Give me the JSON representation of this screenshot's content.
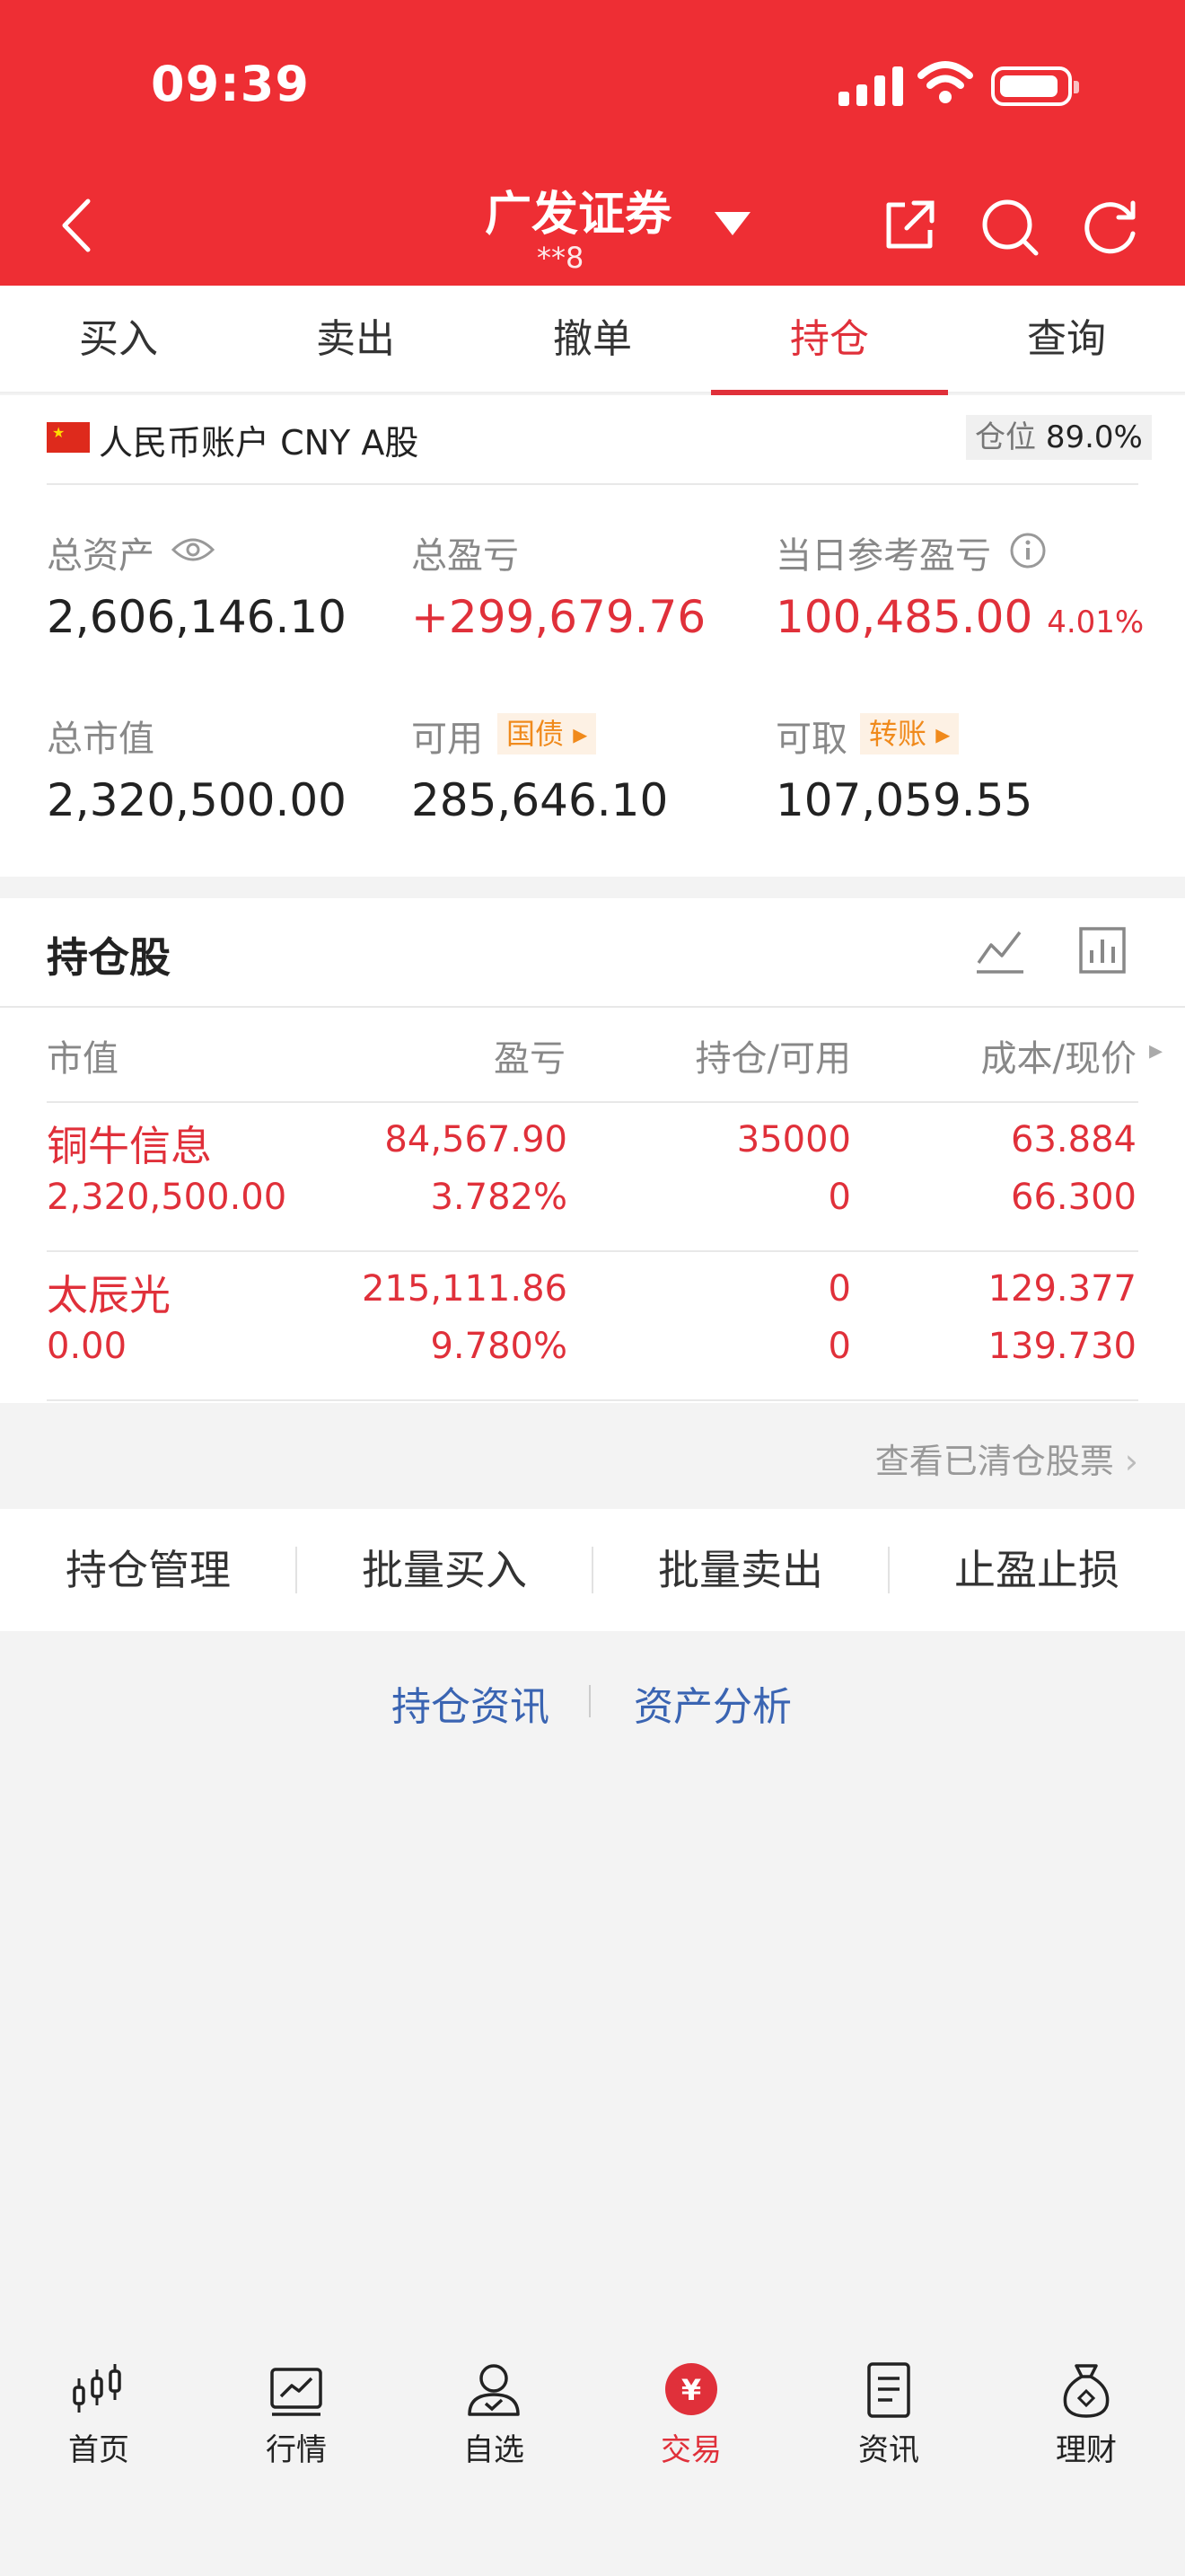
{
  "status_bar": {
    "time": "09:39"
  },
  "header": {
    "brand": "广发证券",
    "account_masked": "**8"
  },
  "tabs": [
    {
      "label": "买入"
    },
    {
      "label": "卖出"
    },
    {
      "label": "撤单"
    },
    {
      "label": "持仓",
      "active": true
    },
    {
      "label": "查询"
    }
  ],
  "account": {
    "label": "人民币账户 CNY A股",
    "position_label": "仓位",
    "position_value": "89.0%",
    "total_assets_label": "总资产",
    "total_assets": "2,606,146.10",
    "total_pnl_label": "总盈亏",
    "total_pnl": "+299,679.76",
    "daily_pnl_label": "当日参考盈亏",
    "daily_pnl": "100,485.00",
    "daily_pnl_pct": "4.01%",
    "market_value_label": "总市值",
    "market_value": "2,320,500.00",
    "available_label": "可用",
    "available_tag": "国债",
    "available": "285,646.10",
    "withdrawable_label": "可取",
    "withdrawable_tag": "转账",
    "withdrawable": "107,059.55"
  },
  "holdings": {
    "title": "持仓股",
    "columns": [
      "市值",
      "盈亏",
      "持仓/可用",
      "成本/现价"
    ],
    "rows": [
      {
        "name": "铜牛信息",
        "market_value": "2,320,500.00",
        "pnl": "84,567.90",
        "pnl_pct": "3.782%",
        "position": "35000",
        "available": "0",
        "cost": "63.884",
        "price": "66.300"
      },
      {
        "name": "太辰光",
        "market_value": "0.00",
        "pnl": "215,111.86",
        "pnl_pct": "9.780%",
        "position": "0",
        "available": "0",
        "cost": "129.377",
        "price": "139.730"
      }
    ],
    "cleared_link": "查看已清仓股票"
  },
  "actions": [
    "持仓管理",
    "批量买入",
    "批量卖出",
    "止盈止损"
  ],
  "links": [
    "持仓资讯",
    "资产分析"
  ],
  "bottom_nav": [
    {
      "label": "首页",
      "icon": "candlestick-icon"
    },
    {
      "label": "行情",
      "icon": "chart-icon"
    },
    {
      "label": "自选",
      "icon": "user-check-icon"
    },
    {
      "label": "交易",
      "icon": "yuan-coin-icon",
      "active": true
    },
    {
      "label": "资讯",
      "icon": "document-icon"
    },
    {
      "label": "理财",
      "icon": "money-bag-icon"
    }
  ],
  "colors": {
    "brand_red": "#ee2e34",
    "up_red": "#e0303a",
    "link_blue": "#3a64b2",
    "tag_orange": "#f08a1c"
  }
}
